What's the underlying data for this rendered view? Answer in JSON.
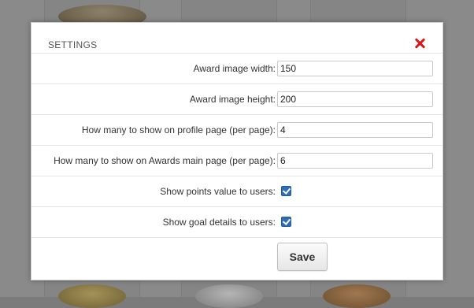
{
  "settings_dialog": {
    "title": "SETTINGS",
    "close_icon": "close-icon",
    "fields": [
      {
        "label": "Award image width:",
        "value": "150"
      },
      {
        "label": "Award image height:",
        "value": "200"
      },
      {
        "label": "How many to show on profile page (per page):",
        "value": "4"
      },
      {
        "label": "How many to show on Awards main page (per page):",
        "value": "6"
      }
    ],
    "checkboxes": [
      {
        "label": "Show points value to users:",
        "checked": true
      },
      {
        "label": "Show goal details to users:",
        "checked": true
      }
    ],
    "save_label": "Save"
  },
  "colors": {
    "close": "#d81818",
    "checkbox": "#2f6db5",
    "overlay": "#7b7b7b"
  }
}
